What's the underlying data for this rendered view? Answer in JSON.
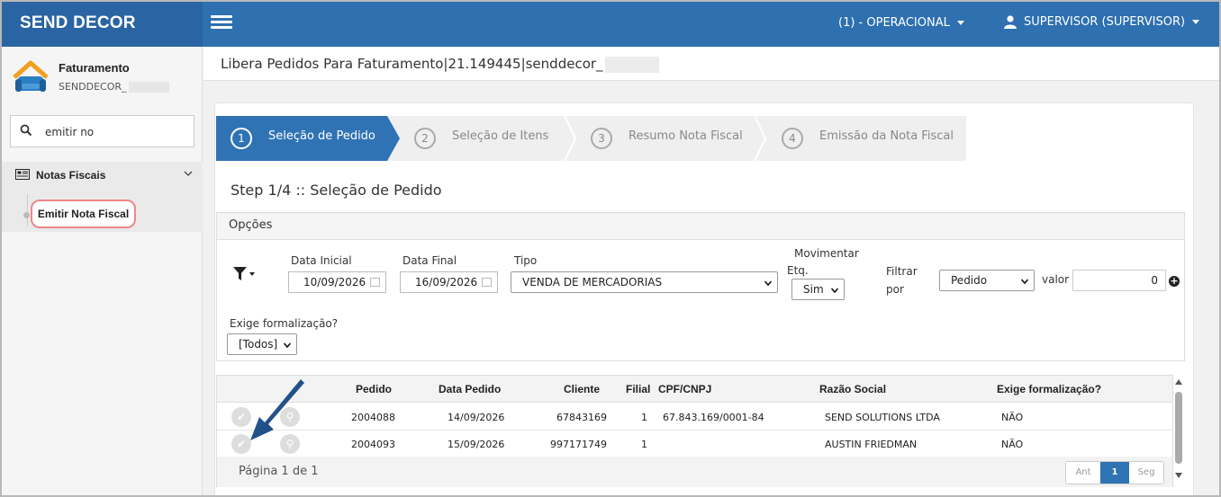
{
  "app": {
    "brand": "SEND DECOR",
    "operation_menu": "(1) - OPERACIONAL",
    "user_menu": "SUPERVISOR (SUPERVISOR)",
    "accent": "#2e70b0"
  },
  "sidebar": {
    "company_name": "Faturamento",
    "company_sub": "SENDDECOR_",
    "search_value": "emitir no",
    "section_label": "Notas Fiscais",
    "item_label": "Emitir Nota Fiscal"
  },
  "page": {
    "header": "Libera Pedidos Para Faturamento|21.149445|senddecor_"
  },
  "wizard": {
    "steps": [
      {
        "num": "1",
        "label": "Seleção de Pedido"
      },
      {
        "num": "2",
        "label": "Seleção de Itens"
      },
      {
        "num": "3",
        "label": "Resumo Nota Fiscal"
      },
      {
        "num": "4",
        "label": "Emissão da Nota Fiscal"
      }
    ],
    "step_title": "Step 1/4 :: Seleção de Pedido"
  },
  "options": {
    "title": "Opções",
    "data_inicial_label": "Data Inicial",
    "data_inicial": "10/09/2026",
    "data_final_label": "Data Final",
    "data_final": "16/09/2026",
    "tipo_label": "Tipo",
    "tipo": "VENDA DE MERCADORIAS",
    "movimentar_label_1": "Movimentar",
    "movimentar_label_2": "Etq.",
    "movimentar": "Sim",
    "filtrar_label_1": "Filtrar",
    "filtrar_label_2": "por",
    "filtrar": "Pedido",
    "valor_label": "valor",
    "valor": "0",
    "exige_label": "Exige formalização?",
    "exige": "[Todos]"
  },
  "table": {
    "headers": {
      "pedido": "Pedido",
      "data": "Data Pedido",
      "cliente": "Cliente",
      "filial": "Filial",
      "cpf": "CPF/CNPJ",
      "razao": "Razão Social",
      "exige": "Exige formalização?"
    },
    "rows": [
      {
        "pedido": "2004088",
        "data": "14/09/2026",
        "cliente": "67843169",
        "filial": "1",
        "cpf": "67.843.169/0001-84",
        "razao": "SEND SOLUTIONS LTDA",
        "exige": "NÃO"
      },
      {
        "pedido": "2004093",
        "data": "15/09/2026",
        "cliente": "997171749",
        "filial": "1",
        "cpf": "",
        "razao": "AUSTIN FRIEDMAN",
        "exige": "NÃO"
      }
    ],
    "page_info": "Página 1 de 1",
    "pager": {
      "prev": "Ant",
      "current": "1",
      "next": "Seg"
    }
  }
}
